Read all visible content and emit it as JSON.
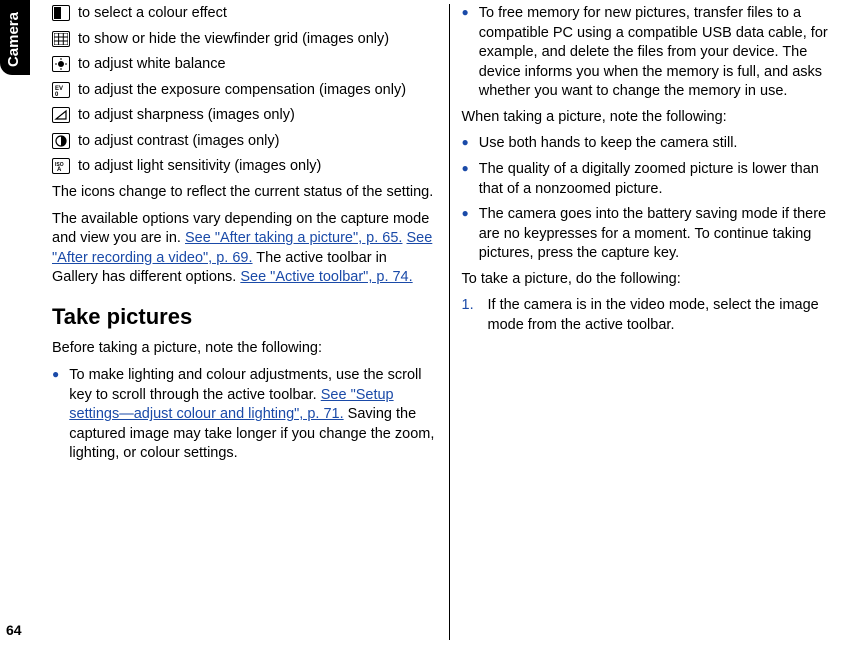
{
  "sideTab": "Camera",
  "pageNumber": "64",
  "col1": {
    "iconLines": [
      {
        "iconName": "colour-effect-icon",
        "text": "to select a colour effect"
      },
      {
        "iconName": "grid-icon",
        "text": "to show or hide the viewfinder grid (images only)"
      },
      {
        "iconName": "white-balance-icon",
        "text": "to adjust white balance"
      },
      {
        "iconName": "exposure-icon",
        "text": "to adjust the exposure compensation (images only)"
      },
      {
        "iconName": "sharpness-icon",
        "text": "to adjust sharpness (images only)"
      },
      {
        "iconName": "contrast-icon",
        "text": "to adjust contrast (images only)"
      },
      {
        "iconName": "iso-icon",
        "text": "to adjust light sensitivity (images only)"
      }
    ],
    "para1": "The icons change to reflect the current status of the setting.",
    "para2a": "The available options vary depending on the capture mode and view you are in. ",
    "link1": "See \"After taking a picture\", p. 65.",
    "sp1": " ",
    "link2": "See \"After recording a video\", p. 69.",
    "para2b": " The active toolbar in Gallery has different options. ",
    "link3": "See \"Active toolbar\", p. 74.",
    "heading": "Take pictures",
    "para3": "Before taking a picture, note the following:",
    "bullet1a": "To make lighting and colour adjustments, use the scroll key to scroll through the active toolbar. ",
    "bullet1link": "See \"Setup settings—adjust colour and lighting\", p. 71.",
    "bullet1b": " Saving the captured image may take longer if you change the zoom, lighting, or colour settings."
  },
  "col2": {
    "bullet2": "To free memory for new pictures, transfer files to a compatible PC using a compatible USB data cable, for example, and delete the files from your device. The device informs you when the memory is full, and asks whether you want to change the memory in use.",
    "para4": "When taking a picture, note the following:",
    "bullet3": "Use both hands to keep the camera still.",
    "bullet4": "The quality of a digitally zoomed picture is lower than that of a nonzoomed picture.",
    "bullet5": "The camera goes into the battery saving mode if there are no keypresses for a moment. To continue taking pictures, press the capture key.",
    "para5": "To take a picture, do the following:",
    "step1": "If the camera is in the video mode, select the image mode from the active toolbar."
  }
}
